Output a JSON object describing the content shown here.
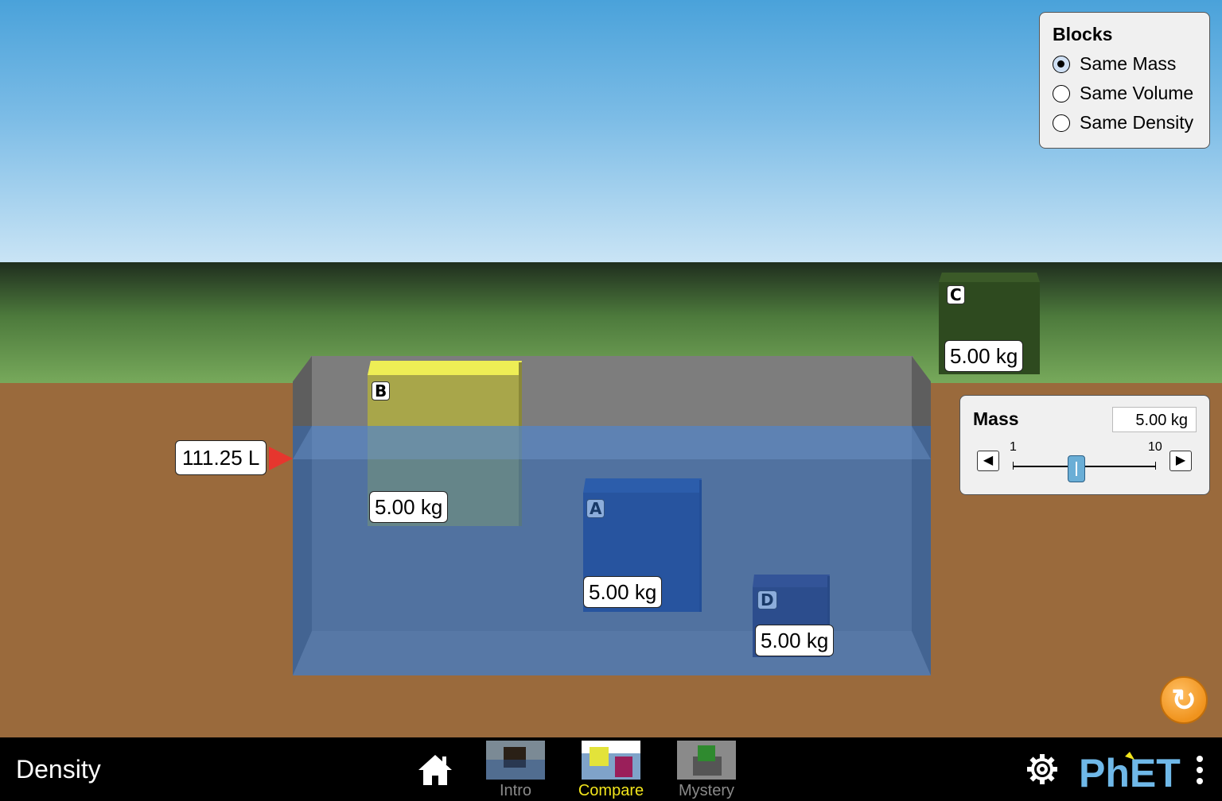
{
  "scene": {
    "volume_readout": "111.25 L",
    "blocks": [
      {
        "id": "B",
        "letter": "B",
        "mass_label": "5.00 kg",
        "color": "#d8d84a"
      },
      {
        "id": "A",
        "letter": "A",
        "mass_label": "5.00 kg",
        "color": "#1f3b7a"
      },
      {
        "id": "D",
        "letter": "D",
        "mass_label": "5.00 kg",
        "color": "#2a2a52"
      },
      {
        "id": "C",
        "letter": "C",
        "mass_label": "5.00 kg",
        "color": "#2e4a1f"
      }
    ],
    "colors": {
      "water": "#2d69be",
      "ground": "#9a6a3c",
      "pool": "#7d7d7d",
      "volume_marker": "#e6362e"
    }
  },
  "blocks_panel": {
    "title": "Blocks",
    "options": [
      {
        "label": "Same Mass",
        "selected": true
      },
      {
        "label": "Same Volume",
        "selected": false
      },
      {
        "label": "Same Density",
        "selected": false
      }
    ]
  },
  "mass_panel": {
    "title": "Mass",
    "value": "5.00 kg",
    "min_label": "1",
    "max_label": "10",
    "min": 1,
    "max": 10,
    "current": 5.0,
    "decrement_icon": "triangle-left-icon",
    "increment_icon": "triangle-right-icon"
  },
  "reset_button": {
    "icon": "reset-icon",
    "color": "#f0931d"
  },
  "navbar": {
    "sim_title": "Density",
    "screens": [
      {
        "label": "Intro",
        "active": false
      },
      {
        "label": "Compare",
        "active": true
      },
      {
        "label": "Mystery",
        "active": false
      }
    ],
    "active_color": "#f2e51c",
    "home_icon": "home-icon",
    "settings_icon": "gear-icon",
    "menu_icon": "kebab-menu-icon",
    "logo": "PhET"
  }
}
